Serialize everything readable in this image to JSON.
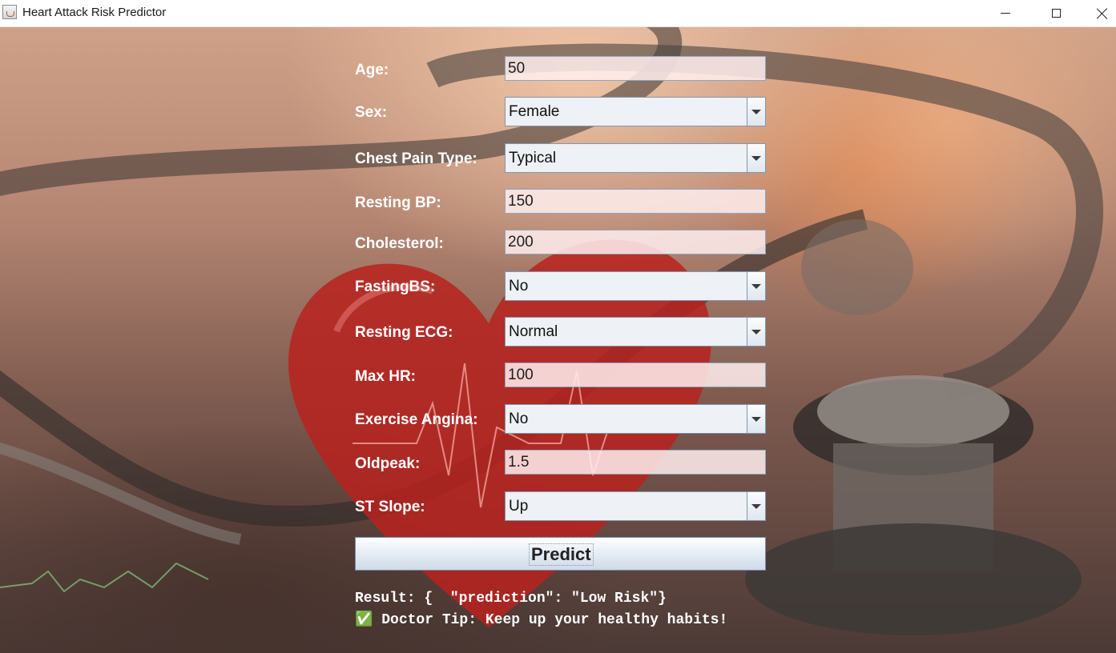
{
  "window": {
    "title": "Heart Attack Risk Predictor"
  },
  "form": {
    "age": {
      "label": "Age:",
      "value": "50"
    },
    "sex": {
      "label": "Sex:",
      "value": "Female"
    },
    "chest_pain": {
      "label": "Chest Pain Type:",
      "value": "Typical"
    },
    "resting_bp": {
      "label": "Resting BP:",
      "value": "150"
    },
    "cholesterol": {
      "label": "Cholesterol:",
      "value": "200"
    },
    "fasting_bs": {
      "label": "FastingBS:",
      "value": "No"
    },
    "resting_ecg": {
      "label": "Resting ECG:",
      "value": "Normal"
    },
    "max_hr": {
      "label": "Max HR:",
      "value": "100"
    },
    "exercise_angina": {
      "label": "Exercise Angina:",
      "value": "No"
    },
    "oldpeak": {
      "label": "Oldpeak:",
      "value": "1.5"
    },
    "st_slope": {
      "label": "ST Slope:",
      "value": "Up"
    }
  },
  "predict_button": {
    "label": "Predict"
  },
  "result": {
    "line1": "Result: {  \"prediction\": \"Low Risk\"}",
    "line2": "✅ Doctor Tip: Keep up your healthy habits!"
  }
}
